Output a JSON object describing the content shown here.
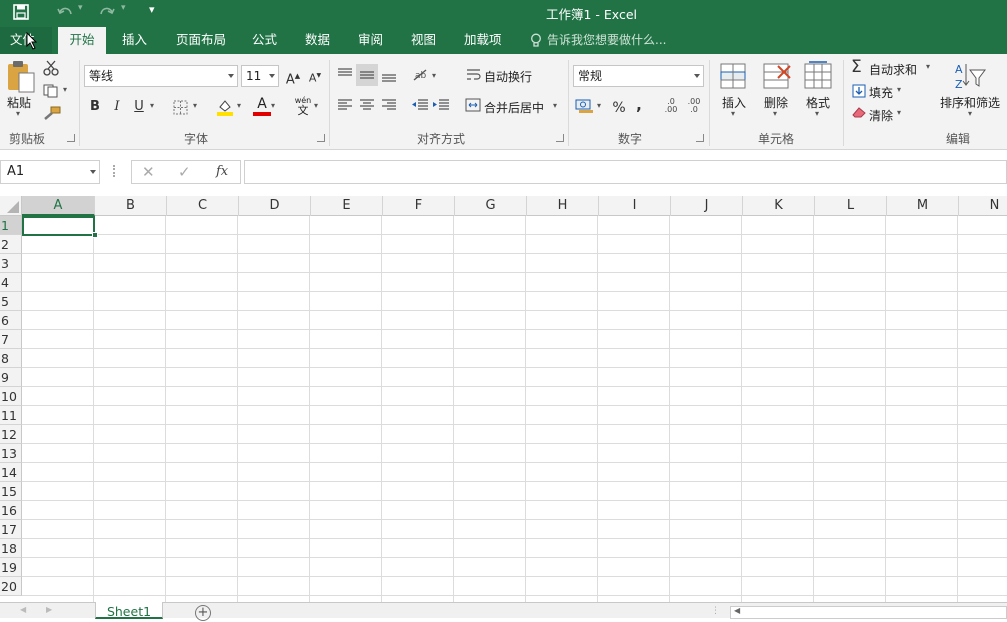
{
  "window": {
    "title": "工作簿1 - Excel"
  },
  "menu": {
    "file": "文件",
    "tabs": [
      "开始",
      "插入",
      "页面布局",
      "公式",
      "数据",
      "审阅",
      "视图",
      "加载项"
    ],
    "tell_me": "告诉我您想要做什么..."
  },
  "clipboard": {
    "paste": "粘贴",
    "group": "剪贴板"
  },
  "font": {
    "name": "等线",
    "size": "11",
    "bold": "B",
    "italic": "I",
    "underline": "U",
    "grow": "A",
    "shrink": "A",
    "color_letter": "A",
    "phonetic_top": "wén",
    "phonetic_bottom": "文",
    "group": "字体",
    "fill_color": "#ffe000",
    "font_color": "#e00000"
  },
  "alignment": {
    "wrap": "自动换行",
    "merge": "合并后居中",
    "group": "对齐方式"
  },
  "number": {
    "format": "常规",
    "percent": "%",
    "comma": ",",
    "inc": ".0 .00",
    "dec": ".00 .0",
    "group": "数字"
  },
  "cells": {
    "insert": "插入",
    "delete": "删除",
    "format": "格式",
    "group": "单元格"
  },
  "editing": {
    "autosum": "自动求和",
    "fill": "填充",
    "clear": "清除",
    "sort": "排序和筛选",
    "group": "编辑"
  },
  "formula_bar": {
    "name_box": "A1",
    "fx": "fx",
    "content": ""
  },
  "columns": [
    "A",
    "B",
    "C",
    "D",
    "E",
    "F",
    "G",
    "H",
    "I",
    "J",
    "K",
    "L",
    "M",
    "N"
  ],
  "rows": [
    "1",
    "2",
    "3",
    "4",
    "5",
    "6",
    "7",
    "8",
    "9",
    "10",
    "11",
    "12",
    "13",
    "14",
    "15",
    "16",
    "17",
    "18",
    "19",
    "20"
  ],
  "sheet": {
    "tab": "Sheet1",
    "add": "+"
  },
  "accent": "#217346"
}
